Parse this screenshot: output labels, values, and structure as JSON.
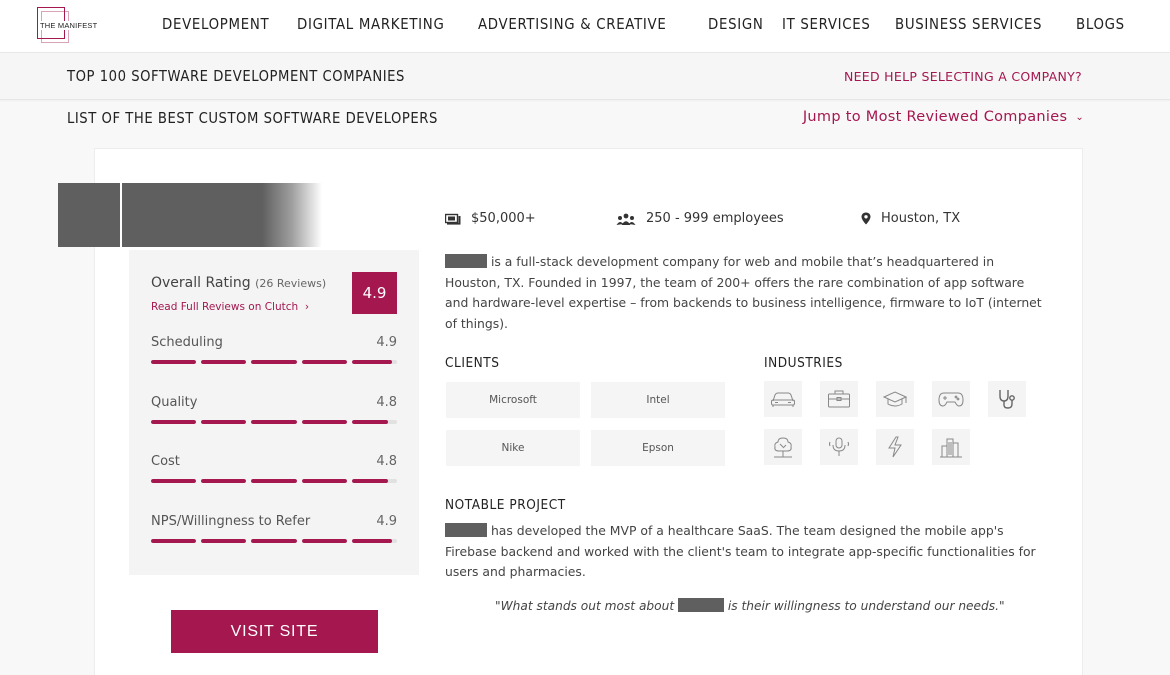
{
  "nav": {
    "logo_text": "THE MANIFEST",
    "items": [
      "DEVELOPMENT",
      "DIGITAL MARKETING",
      "ADVERTISING & CREATIVE",
      "DESIGN",
      "IT SERVICES",
      "BUSINESS SERVICES",
      "BLOGS"
    ]
  },
  "subheader": {
    "title": "TOP 100 SOFTWARE DEVELOPMENT COMPANIES",
    "help_link": "NEED HELP SELECTING A COMPANY?"
  },
  "list": {
    "title": "LIST OF THE BEST CUSTOM SOFTWARE DEVELOPERS",
    "jump_link": "Jump to Most Reviewed Companies"
  },
  "company": {
    "overall_label": "Overall Rating",
    "review_count": "(26 Reviews)",
    "read_reviews": "Read Full Reviews on Clutch",
    "overall_score": "4.9",
    "metrics": [
      {
        "label": "Scheduling",
        "value": "4.9",
        "fill": 0.98
      },
      {
        "label": "Quality",
        "value": "4.8",
        "fill": 0.96
      },
      {
        "label": "Cost",
        "value": "4.8",
        "fill": 0.96
      },
      {
        "label": "NPS/Willingness to Refer",
        "value": "4.9",
        "fill": 0.98
      }
    ],
    "visit_label": "VISIT SITE",
    "min_project": "$50,000+",
    "employees": "250 - 999 employees",
    "location": "Houston, TX",
    "description_line1": " is a full-stack development company for web and mobile that’s headquartered in",
    "description_rest": "Houston, TX. Founded in 1997, the team of 200+ offers the rare combination of app software and hardware-level expertise – from backends to business intelligence, firmware to IoT (internet of things).",
    "clients_heading": "CLIENTS",
    "clients": [
      "Microsoft",
      "Intel",
      "Nike",
      "Epson"
    ],
    "industries_heading": "INDUSTRIES",
    "industries": [
      "car-icon",
      "briefcase-icon",
      "graduation-cap-icon",
      "gamepad-icon",
      "stethoscope-icon",
      "tree-icon",
      "microphone-icon",
      "lightning-icon",
      "city-icon"
    ],
    "notable_heading": "NOTABLE PROJECT",
    "notable_line1": " has developed the MVP of a healthcare SaaS. The team designed the mobile app's",
    "notable_rest": "Firebase backend and worked with the client's team to integrate app-specific functionalities for users and pharmacies.",
    "quote_start": "\"What stands out most about ",
    "quote_end": " is their willingness to understand our needs.\""
  },
  "colors": {
    "brand": "#a4174f",
    "redaction": "#5f5f5f"
  }
}
